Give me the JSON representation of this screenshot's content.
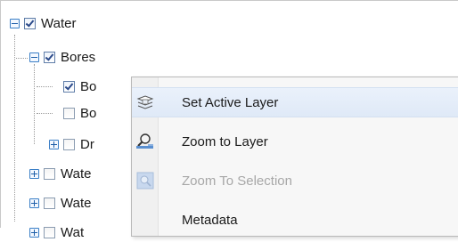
{
  "tree": {
    "items": [
      {
        "label": "Water",
        "checked": true,
        "expander": "minus"
      },
      {
        "label": "Bores",
        "checked": true,
        "expander": "minus"
      },
      {
        "label": "Bo",
        "checked": true,
        "expander": "none"
      },
      {
        "label": "Bo",
        "checked": false,
        "expander": "none"
      },
      {
        "label": "Dr",
        "checked": false,
        "expander": "plus"
      },
      {
        "label": "Wate",
        "checked": false,
        "expander": "plus"
      },
      {
        "label": "Wate",
        "checked": false,
        "expander": "plus"
      },
      {
        "label": "Wat",
        "checked": false,
        "expander": "plus"
      }
    ]
  },
  "context_menu": {
    "items": [
      {
        "label": "Set Active Layer",
        "icon": "set-active-layer-icon",
        "enabled": true,
        "highlighted": true
      },
      {
        "label": "Zoom to Layer",
        "icon": "zoom-to-layer-icon",
        "enabled": true,
        "highlighted": false
      },
      {
        "label": "Zoom To Selection",
        "icon": "zoom-to-selection-icon",
        "enabled": false,
        "highlighted": false
      },
      {
        "label": "Metadata",
        "icon": "",
        "enabled": true,
        "highlighted": false
      }
    ]
  },
  "colors": {
    "expander_border": "#3a7ec6",
    "menu_hover": "#dfe9f7",
    "disabled_text": "#a7a7a7"
  }
}
